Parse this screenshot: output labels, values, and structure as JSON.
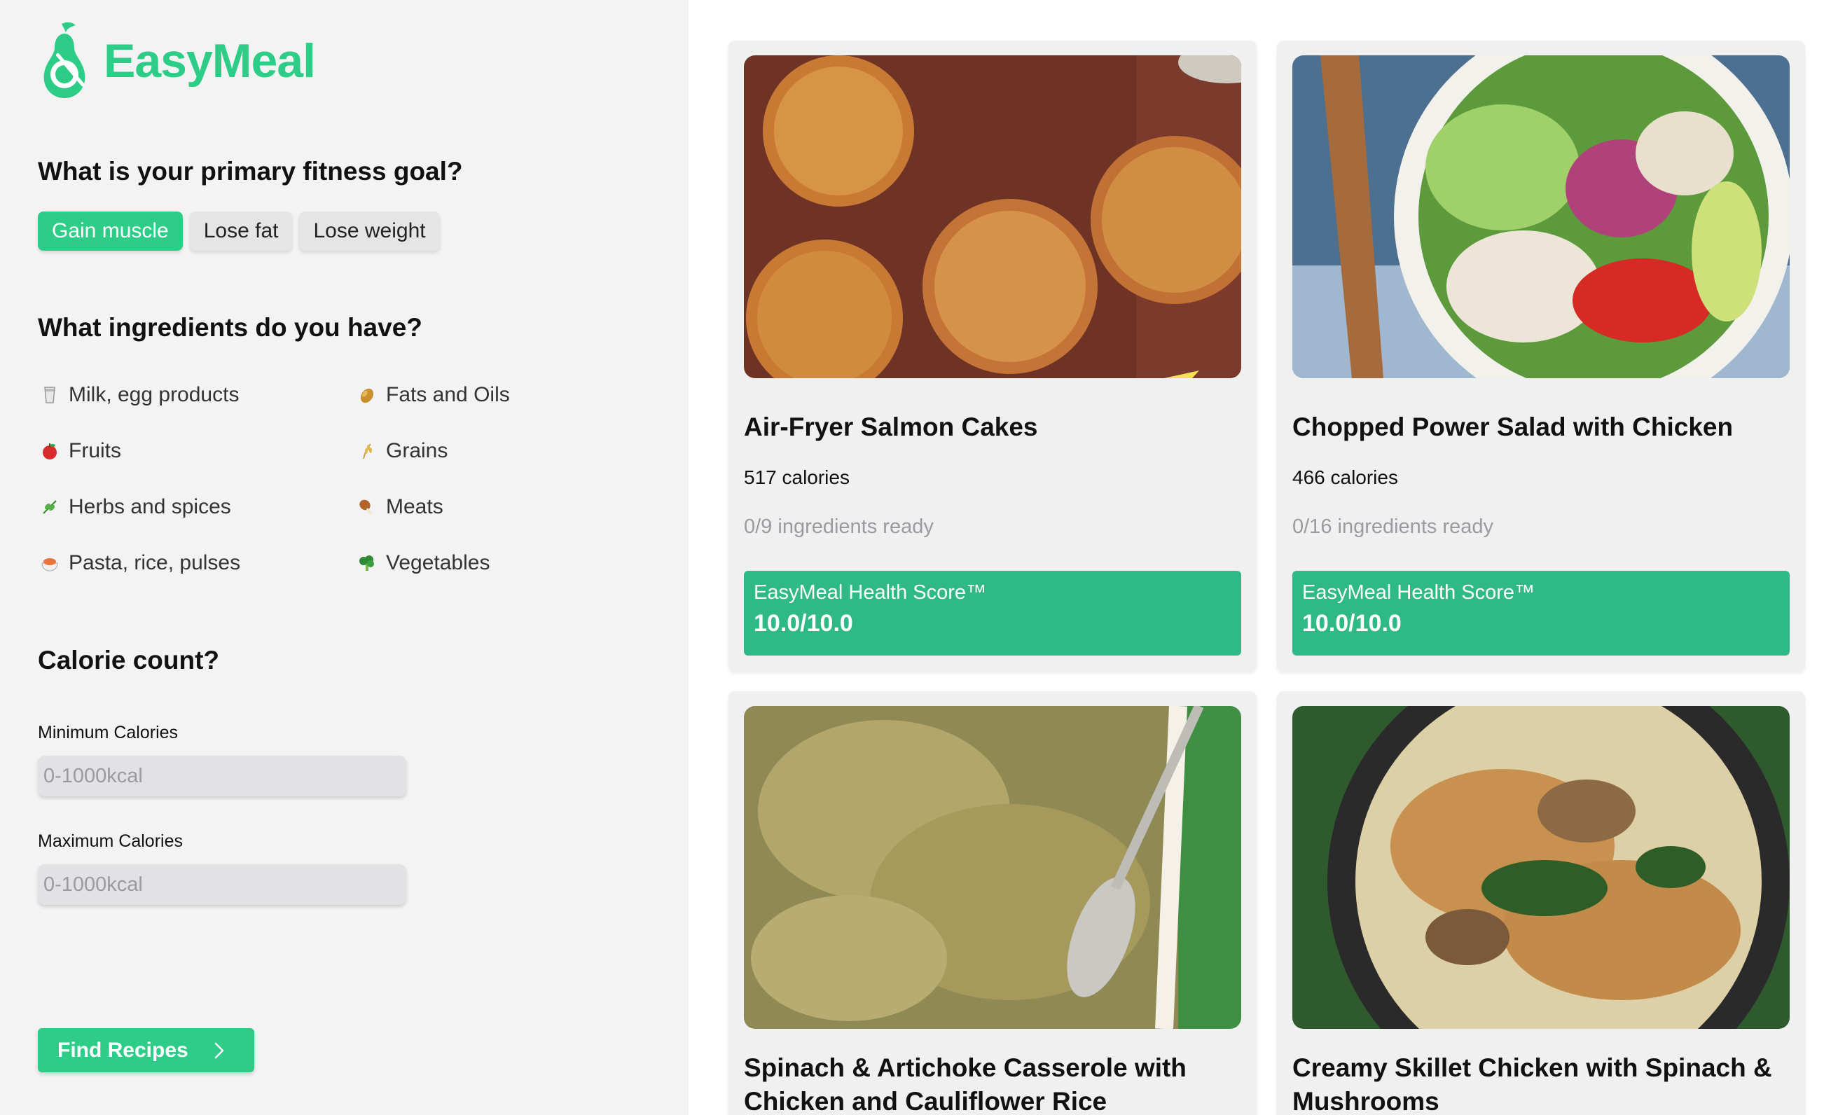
{
  "brand": {
    "name": "EasyMeal",
    "accent": "#2dcd87"
  },
  "goal": {
    "question": "What is your primary fitness goal?",
    "options": [
      {
        "label": "Gain muscle",
        "selected": true
      },
      {
        "label": "Lose fat",
        "selected": false
      },
      {
        "label": "Lose weight",
        "selected": false
      }
    ]
  },
  "ingredients": {
    "question": "What ingredients do you have?",
    "items": [
      {
        "label": "Milk, egg products",
        "icon": "milk-icon"
      },
      {
        "label": "Fats and Oils",
        "icon": "oil-icon"
      },
      {
        "label": "Fruits",
        "icon": "apple-icon"
      },
      {
        "label": "Grains",
        "icon": "grain-icon"
      },
      {
        "label": "Herbs and spices",
        "icon": "herb-icon"
      },
      {
        "label": "Meats",
        "icon": "drumstick-icon"
      },
      {
        "label": "Pasta, rice, pulses",
        "icon": "pasta-icon"
      },
      {
        "label": "Vegetables",
        "icon": "broccoli-icon"
      }
    ]
  },
  "calories": {
    "question": "Calorie count?",
    "min_label": "Minimum Calories",
    "min_placeholder": "0-1000kcal",
    "max_label": "Maximum Calories",
    "max_placeholder": "0-1000kcal"
  },
  "find_button": {
    "label": "Find Recipes",
    "icon": "chevron-right-icon"
  },
  "recipes": [
    {
      "title": "Air-Fryer Salmon Cakes",
      "calories": "517 calories",
      "ready": "0/9 ingredients ready",
      "score_label": "EasyMeal Health Score™",
      "score": "10.0/10.0"
    },
    {
      "title": "Chopped Power Salad with Chicken",
      "calories": "466 calories",
      "ready": "0/16 ingredients ready",
      "score_label": "EasyMeal Health Score™",
      "score": "10.0/10.0"
    },
    {
      "title": "Spinach & Artichoke Casserole with Chicken and Cauliflower Rice"
    },
    {
      "title": "Creamy Skillet Chicken with Spinach & Mushrooms"
    }
  ]
}
